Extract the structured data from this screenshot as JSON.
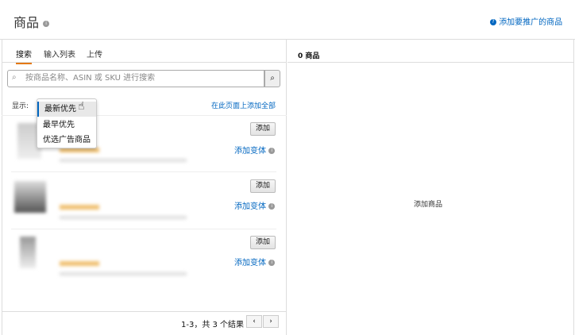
{
  "header": {
    "title": "商品",
    "promote_link": "添加要推广的商品"
  },
  "tabs": [
    {
      "label": "搜索"
    },
    {
      "label": "输入列表"
    },
    {
      "label": "上传"
    }
  ],
  "search": {
    "placeholder": "按商品名称、ASIN 或 SKU 进行搜索"
  },
  "display": {
    "label": "显示:",
    "add_all": "在此页面上添加全部"
  },
  "sort_options": [
    "最新优先",
    "最早优先",
    "优选广告商品"
  ],
  "products": [
    {
      "add_label": "添加",
      "variant_link": "添加变体"
    },
    {
      "add_label": "添加",
      "variant_link": "添加变体"
    },
    {
      "add_label": "添加",
      "variant_link": "添加变体"
    }
  ],
  "pagination": {
    "summary": "1-3，共 3 个结果",
    "prev": "‹",
    "next": "›"
  },
  "right": {
    "count": "0 商品",
    "empty": "添加商品"
  }
}
